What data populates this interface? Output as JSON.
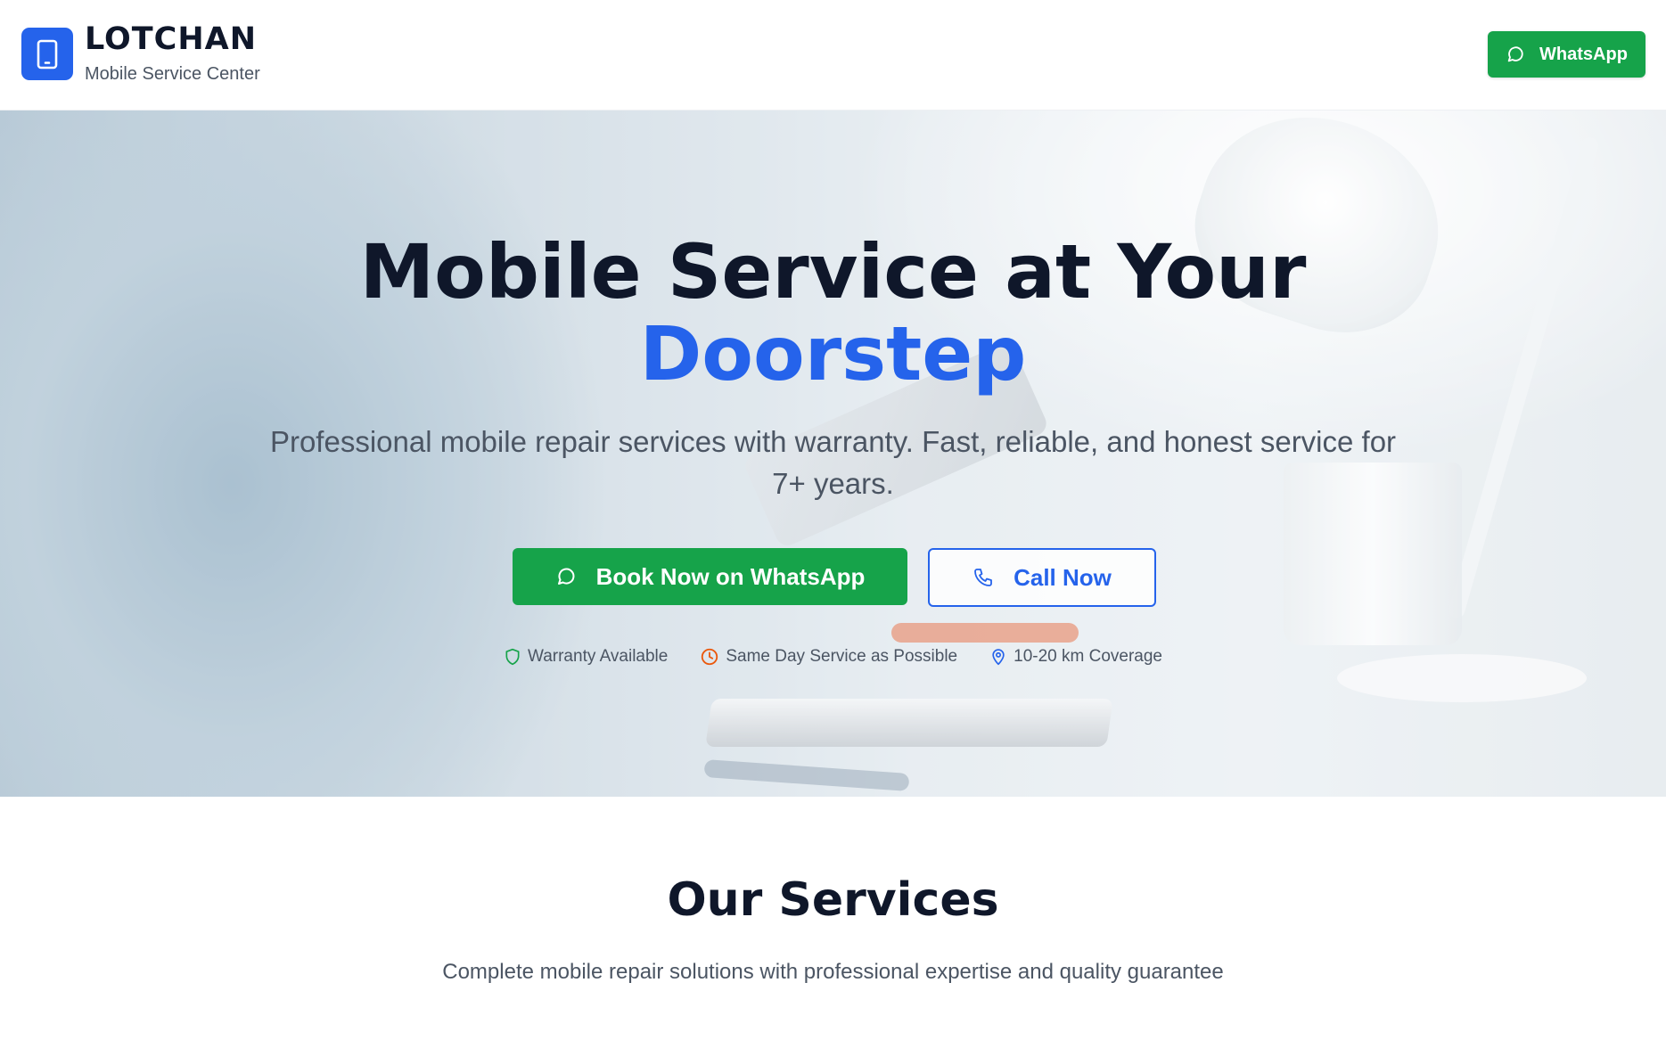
{
  "header": {
    "brand_name": "LOTCHAN",
    "brand_tagline": "Mobile Service Center",
    "logo_icon": "phone-icon",
    "whatsapp_label": "WhatsApp"
  },
  "hero": {
    "title_line1": "Mobile Service at Your",
    "title_accent": "Doorstep",
    "subtitle": "Professional mobile repair services with warranty. Fast, reliable, and honest service for 7+ years.",
    "book_button": "Book Now on WhatsApp",
    "call_button": "Call Now",
    "features": [
      {
        "icon": "shield-icon",
        "label": "Warranty Available",
        "color": "#16a34a"
      },
      {
        "icon": "clock-icon",
        "label": "Same Day Service as Possible",
        "color": "#ea580c"
      },
      {
        "icon": "map-pin-icon",
        "label": "10-20 km Coverage",
        "color": "#2563eb"
      }
    ]
  },
  "services": {
    "title": "Our Services",
    "subtitle": "Complete mobile repair solutions with professional expertise and quality guarantee"
  },
  "colors": {
    "primary": "#2563eb",
    "whatsapp_green": "#16a34a",
    "text_dark": "#0f172a",
    "text_muted": "#4b5563"
  }
}
